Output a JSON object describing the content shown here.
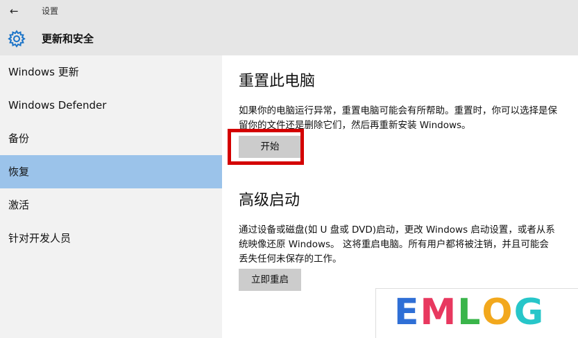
{
  "window": {
    "title": "设置"
  },
  "header": {
    "title": "更新和安全"
  },
  "sidebar": {
    "items": [
      {
        "label": "Windows 更新"
      },
      {
        "label": "Windows Defender"
      },
      {
        "label": "备份"
      },
      {
        "label": "恢复",
        "selected": true
      },
      {
        "label": "激活"
      },
      {
        "label": "针对开发人员"
      }
    ]
  },
  "main": {
    "reset": {
      "title": "重置此电脑",
      "description": "如果你的电脑运行异常，重置电脑可能会有所帮助。重置时，你可以选择是保留你的文件还是删除它们，然后再重新安装 Windows。",
      "button_label": "开始"
    },
    "advanced": {
      "title": "高级启动",
      "description": "通过设备或磁盘(如 U 盘或 DVD)启动，更改 Windows 启动设置，或者从系统映像还原 Windows。 这将重启电脑。所有用户都将被注销，并且可能会丢失任何未保存的工作。",
      "button_label": "立即重启"
    }
  },
  "watermark": {
    "letters": [
      {
        "char": "E",
        "color": "#2f6fd6"
      },
      {
        "char": "M",
        "color": "#e8385f"
      },
      {
        "char": "L",
        "color": "#3ab54a"
      },
      {
        "char": "O",
        "color": "#f2a81d"
      },
      {
        "char": "G",
        "color": "#27c6c9"
      }
    ]
  },
  "colors": {
    "selected_nav": "#9bc3ea",
    "highlight_border": "#d40000",
    "button_bg": "#cccccc"
  }
}
